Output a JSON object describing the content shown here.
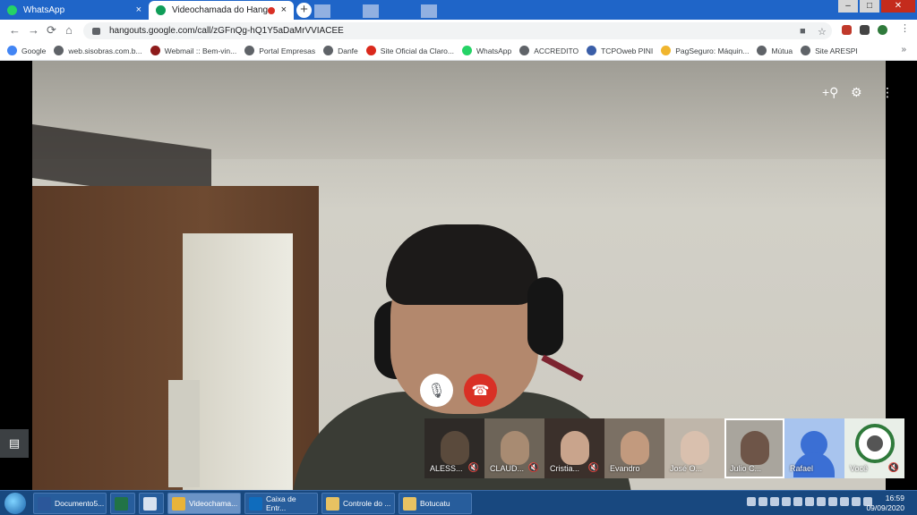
{
  "browser": {
    "tabs": [
      {
        "label": "WhatsApp",
        "close": "×"
      },
      {
        "label": "Videochamada do Hangouts",
        "close": "×"
      }
    ],
    "new_tab": "+",
    "window_controls": {
      "minimize": "–",
      "maximize": "□",
      "close": "✕"
    },
    "url": "hangouts.google.com/call/zGFnQg-hQ1Y5aDaMrVVIACEE",
    "nav": {
      "back": "←",
      "forward": "→",
      "reload": "⟳",
      "home": "⌂"
    },
    "omni_icons": {
      "camera": "■",
      "star": "☆"
    },
    "bookmarks": [
      {
        "label": "Google",
        "icon": "google-icon"
      },
      {
        "label": "web.sisobras.com.b...",
        "icon": "globe-icon"
      },
      {
        "label": "Webmail :: Bem-vin...",
        "icon": "webmail-icon"
      },
      {
        "label": "Portal Empresas",
        "icon": "globe-icon"
      },
      {
        "label": "Danfe",
        "icon": "globe-icon"
      },
      {
        "label": "Site Oficial da Claro...",
        "icon": "claro-icon"
      },
      {
        "label": "WhatsApp",
        "icon": "whatsapp-icon"
      },
      {
        "label": "ACCREDITO",
        "icon": "globe-icon"
      },
      {
        "label": "TCPOweb PINI",
        "icon": "pini-icon"
      },
      {
        "label": "PagSeguro: Máquin...",
        "icon": "pagseguro-icon"
      },
      {
        "label": "Mútua",
        "icon": "globe-icon"
      },
      {
        "label": "Site ARESPI",
        "icon": "globe-icon"
      }
    ],
    "bookmarks_more": "»"
  },
  "call": {
    "icons": {
      "add_person": "+⚲",
      "settings": "⚙",
      "more": "⋮",
      "mute": "🎙",
      "hangup": "☎",
      "chat": "▤"
    },
    "participants": [
      {
        "name": "ALESS...",
        "muted": true,
        "skin": "#5a4a3c",
        "bg": "#2e2a27"
      },
      {
        "name": "CLAUD...",
        "muted": true,
        "skin": "#a88b72",
        "bg": "#6d6458"
      },
      {
        "name": "Cristia...",
        "muted": true,
        "skin": "#c9a48c",
        "bg": "#3b302b"
      },
      {
        "name": "Evandro",
        "muted": false,
        "skin": "#c29a7e",
        "bg": "#7b7064"
      },
      {
        "name": "José O...",
        "muted": false,
        "skin": "#d9c0ae",
        "bg": "#bfb6aa"
      },
      {
        "name": "Julio C...",
        "muted": false,
        "skin": "#6e5548",
        "bg": "#a9a59d"
      },
      {
        "name": "Rafael",
        "muted": false,
        "avatar": true,
        "bg": "#a8c4ee"
      },
      {
        "name": "Você",
        "muted": true,
        "seal": true,
        "bg": "#e9efe8"
      }
    ],
    "mute_glyph": "🔇"
  },
  "taskbar": {
    "items": [
      {
        "label": "Documento5...",
        "color": "#2b579a",
        "width": 82
      },
      {
        "label": "",
        "color": "#217346",
        "width": 28
      },
      {
        "label": "",
        "color": "#d8e2ef",
        "width": 28
      },
      {
        "label": "Videochama...",
        "color": "#e8b33a",
        "width": 82,
        "selected": true
      },
      {
        "label": "Caixa de Entr...",
        "color": "#0f6cbd",
        "width": 82
      },
      {
        "label": "Controle do ...",
        "color": "#e8c262",
        "width": 82
      },
      {
        "label": "Botucatu",
        "color": "#e8c262",
        "width": 82
      }
    ],
    "time": "16:59",
    "date": "09/09/2020"
  }
}
